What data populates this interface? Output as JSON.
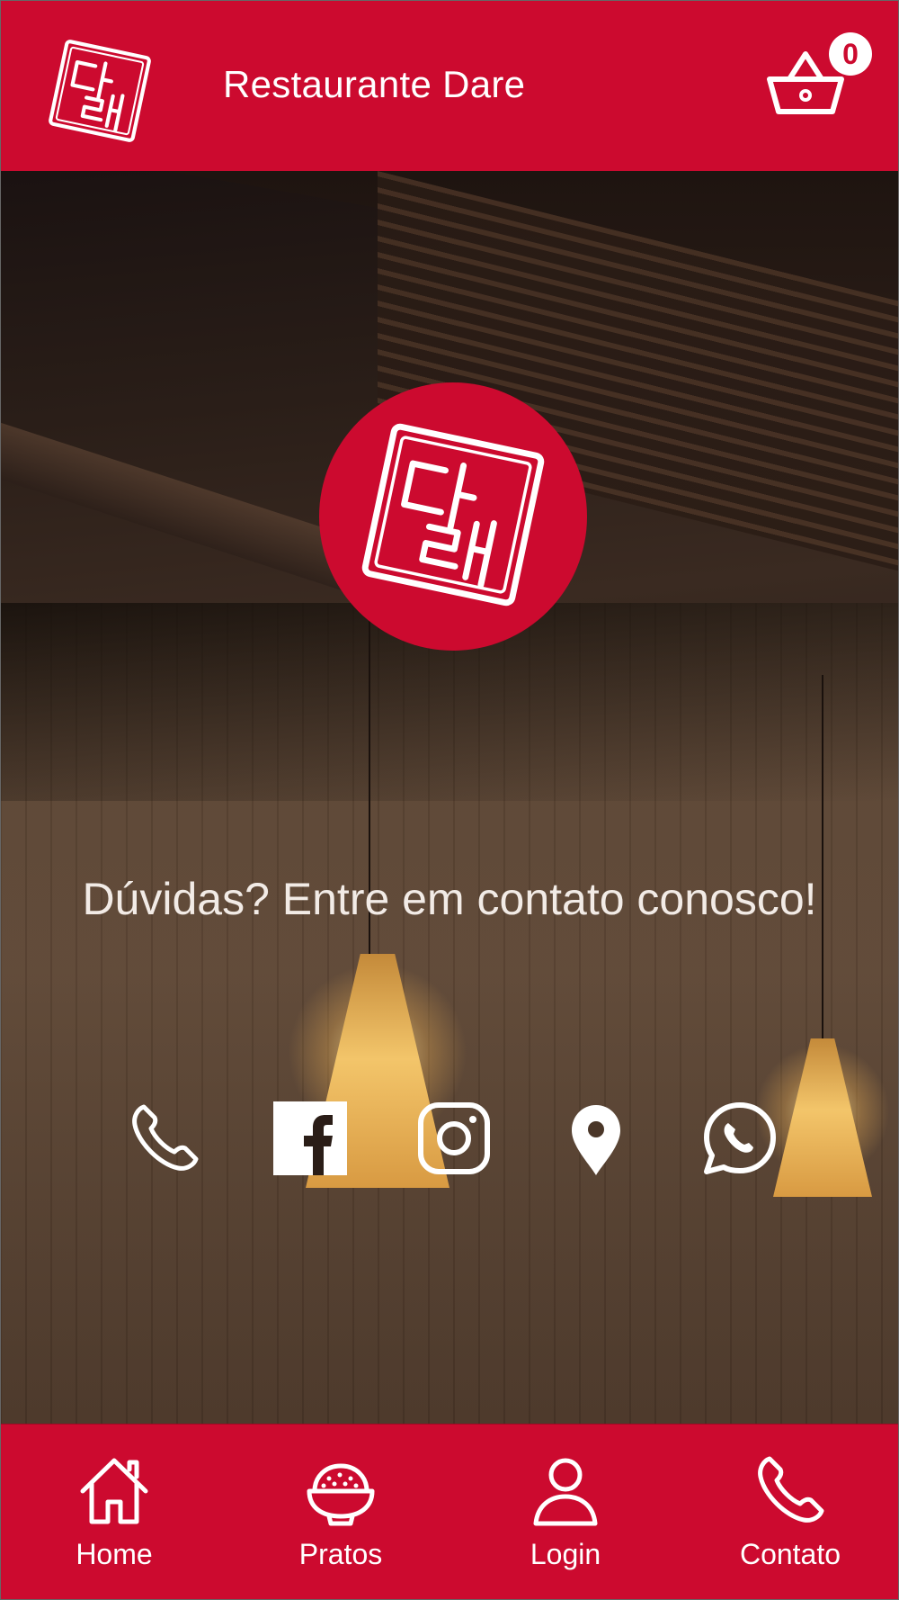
{
  "header": {
    "title": "Restaurante Dare",
    "logo_icon": "restaurant-logo-icon",
    "cart_icon": "shopping-basket-icon",
    "cart_count": "0"
  },
  "hero": {
    "logo_icon": "restaurant-logo-icon",
    "contact_text": "Dúvidas? Entre em contato conosco!",
    "social_links": [
      {
        "name": "phone-link",
        "icon": "phone-icon"
      },
      {
        "name": "facebook-link",
        "icon": "facebook-icon"
      },
      {
        "name": "instagram-link",
        "icon": "instagram-icon"
      },
      {
        "name": "location-link",
        "icon": "location-pin-icon"
      },
      {
        "name": "whatsapp-link",
        "icon": "whatsapp-icon"
      }
    ]
  },
  "bottom_nav": {
    "items": [
      {
        "label": "Home",
        "icon": "home-icon"
      },
      {
        "label": "Pratos",
        "icon": "rice-bowl-icon"
      },
      {
        "label": "Login",
        "icon": "user-icon"
      },
      {
        "label": "Contato",
        "icon": "phone-icon"
      }
    ]
  },
  "colors": {
    "brand_red": "#cc0a2f",
    "text_light": "#f2ebe6",
    "white": "#ffffff"
  }
}
